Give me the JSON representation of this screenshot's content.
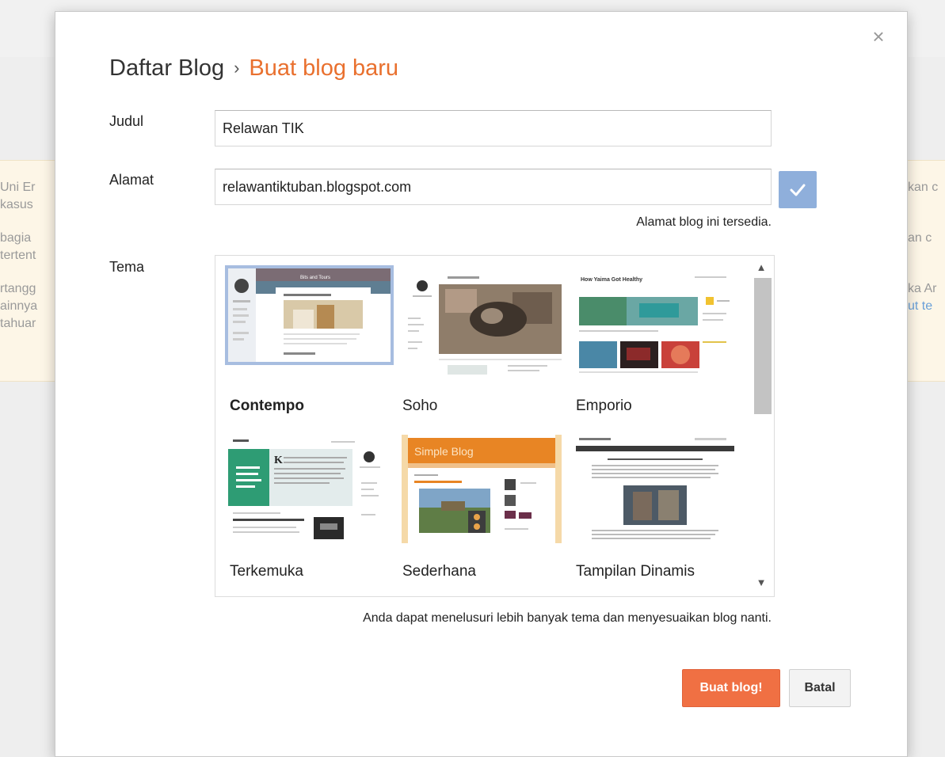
{
  "background": {
    "left_lines": [
      "Uni Er",
      "kasus",
      "bagia",
      "tertent",
      "rtangg",
      "ainnya",
      "tahuar"
    ],
    "right_lines": [
      "kan c",
      "an c",
      "ka Ar",
      "ut te"
    ]
  },
  "dialog": {
    "close_icon": "×",
    "breadcrumb": {
      "parent": "Daftar Blog",
      "separator": "›",
      "current": "Buat blog baru"
    },
    "title_label": "Judul",
    "title_value": "Relawan TIK",
    "address_label": "Alamat",
    "address_value": "relawantiktuban.blogspot.com",
    "address_status": "Alamat blog ini tersedia.",
    "theme_label": "Tema",
    "themes": [
      {
        "name": "Contempo",
        "selected": true
      },
      {
        "name": "Soho",
        "selected": false
      },
      {
        "name": "Emporio",
        "selected": false
      },
      {
        "name": "Terkemuka",
        "selected": false
      },
      {
        "name": "Sederhana",
        "selected": false
      },
      {
        "name": "Tampilan Dinamis",
        "selected": false
      }
    ],
    "theme_preview_texts": {
      "contempo": "Bits and Tours",
      "emporio": "How Yaima Got Healthy",
      "sederhana": "Simple Blog"
    },
    "theme_hint": "Anda dapat menelusuri lebih banyak tema dan menyesuaikan blog nanti.",
    "create_button": "Buat blog!",
    "cancel_button": "Batal"
  },
  "colors": {
    "accent_orange": "#e9702e",
    "create_button": "#f07043",
    "check_button": "#8fafdb",
    "selection_outline": "#a7bde0"
  }
}
